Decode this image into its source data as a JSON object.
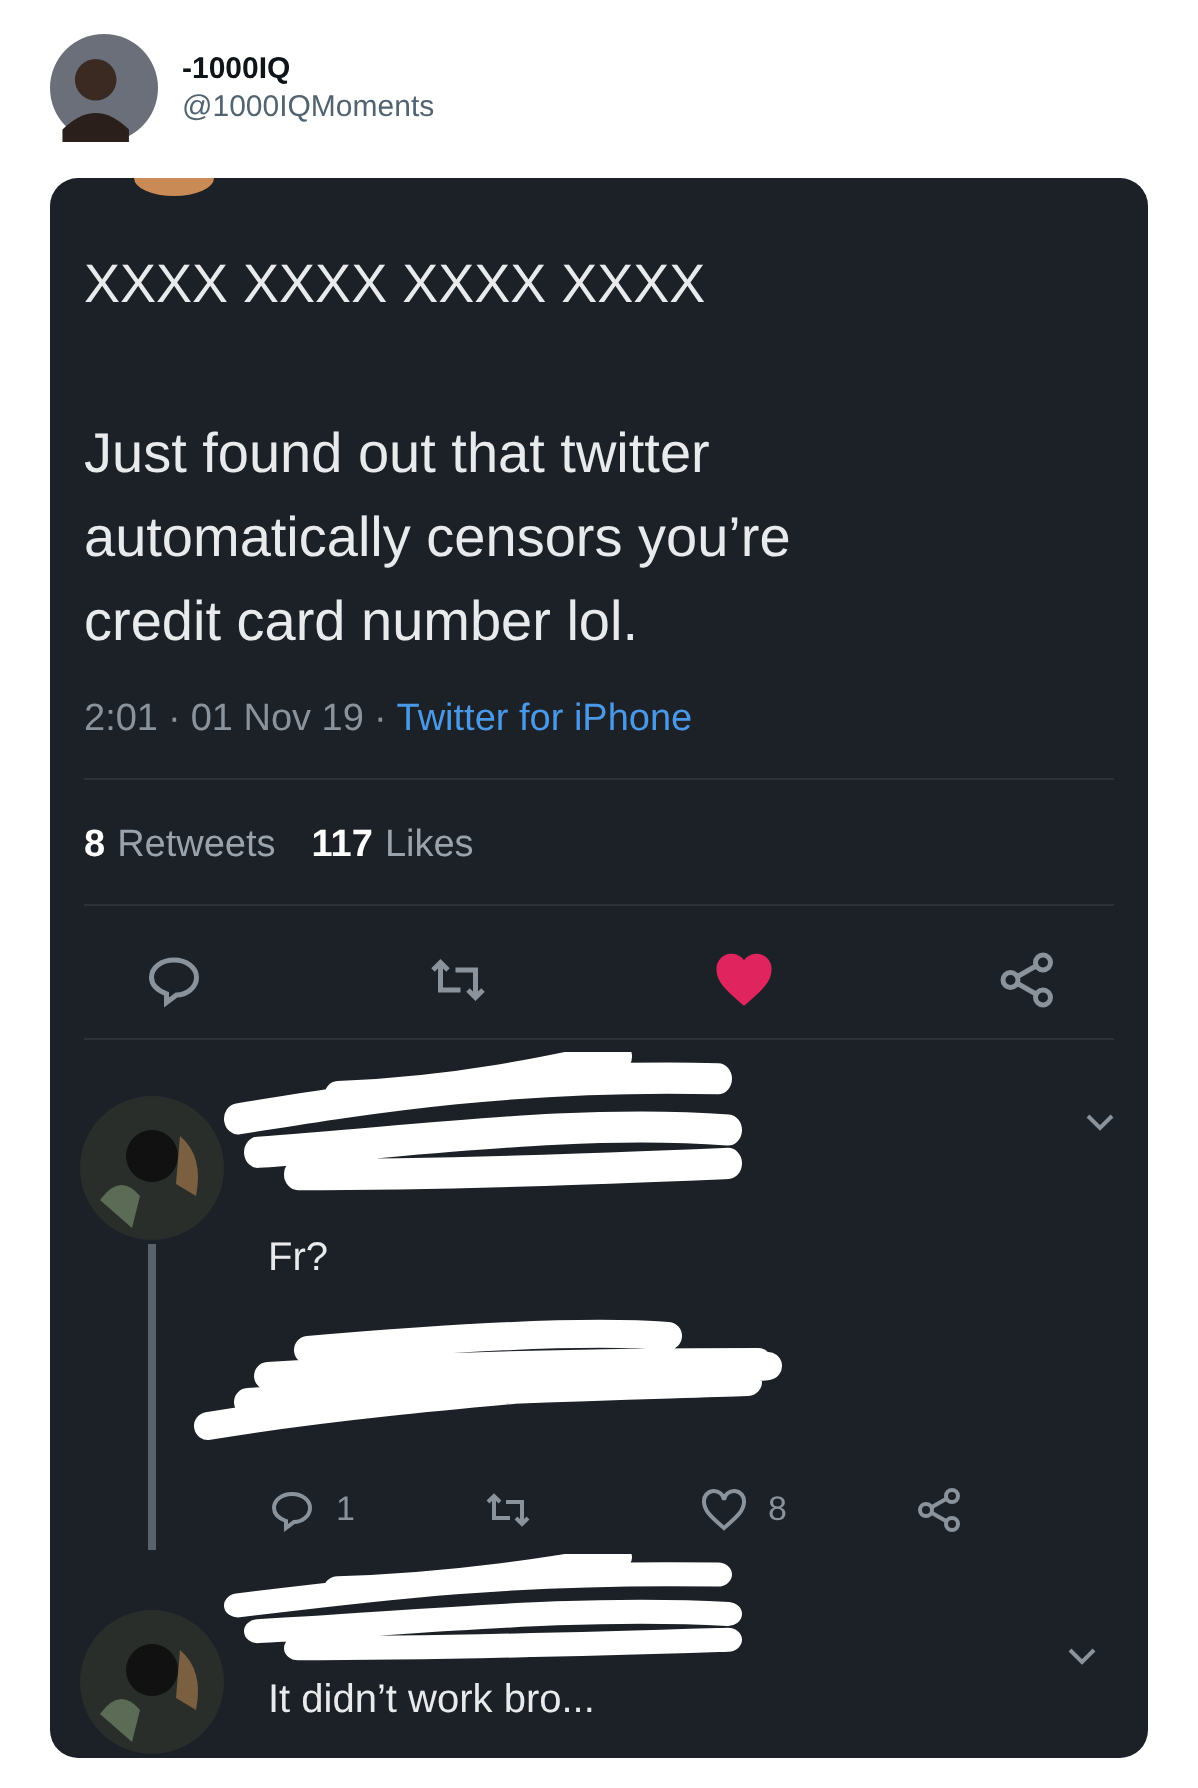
{
  "author": {
    "name": "-1000IQ",
    "handle": "@1000IQMoments"
  },
  "tweet": {
    "title": "XXXX XXXX XXXX XXXX",
    "body_lines": [
      "Just found out that twitter",
      "automatically censors you’re",
      "credit card number lol."
    ],
    "time": "2:01",
    "separator": "·",
    "date": "01 Nov 19",
    "source": "Twitter for iPhone",
    "retweets": "8",
    "retweets_label": "Retweets",
    "likes": "117",
    "likes_label": "Likes",
    "liked": true
  },
  "replies": [
    {
      "text": "Fr?",
      "reply_count": "1",
      "like_count": "8",
      "liked": false
    },
    {
      "text": "It didn’t work bro..."
    }
  ]
}
